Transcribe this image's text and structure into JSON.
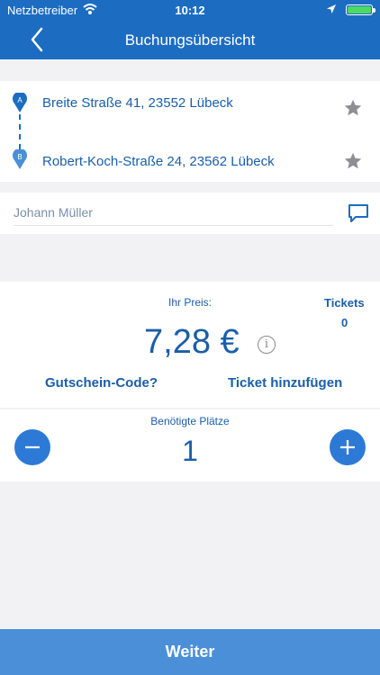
{
  "status_bar": {
    "carrier": "Netzbetreiber",
    "time": "10:12",
    "battery_level": 1.0
  },
  "nav": {
    "title": "Buchungsübersicht"
  },
  "route": {
    "from_marker": "A",
    "from_address": "Breite Straße 41, 23552 Lübeck",
    "to_marker": "B",
    "to_address": "Robert-Koch-Straße 24, 23562 Lübeck"
  },
  "passenger": {
    "name": "Johann Müller"
  },
  "price": {
    "label": "Ihr Preis:",
    "amount": "7,28 €",
    "info_glyph": "i",
    "tickets_label": "Tickets",
    "tickets_count": "0",
    "voucher_link": "Gutschein-Code?",
    "add_ticket_link": "Ticket hinzufügen"
  },
  "seats": {
    "label": "Benötigte Plätze",
    "count": "1"
  },
  "footer": {
    "continue_label": "Weiter"
  },
  "colors": {
    "primary": "#1c6dc2",
    "text_blue": "#1a5ea8",
    "stepper": "#2d7ad6",
    "footer_button": "#4a8fd8"
  }
}
